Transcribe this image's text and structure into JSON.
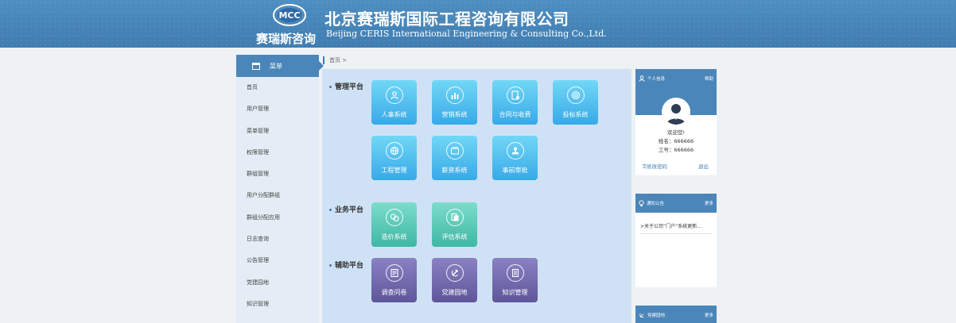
{
  "header": {
    "logo_text": "赛瑞斯咨询",
    "company_cn": "北京赛瑞斯国际工程咨询有限公司",
    "company_en": "Beijing CERIS International Engineering & Consulting Co.,Ltd."
  },
  "sidebar": {
    "title": "菜单",
    "items": [
      {
        "label": "首页"
      },
      {
        "label": "用户管理"
      },
      {
        "label": "菜单管理"
      },
      {
        "label": "权限管理"
      },
      {
        "label": "群组管理"
      },
      {
        "label": "用户分配群组"
      },
      {
        "label": "群组分配应用"
      },
      {
        "label": "日志查询"
      },
      {
        "label": "公告管理"
      },
      {
        "label": "党建园地"
      },
      {
        "label": "知识管理"
      }
    ]
  },
  "breadcrumb": {
    "text": "首页 >"
  },
  "sections": {
    "management": {
      "title": "管理平台"
    },
    "business": {
      "title": "业务平台"
    },
    "auxiliary": {
      "title": "辅助平台"
    }
  },
  "tiles": [
    {
      "label": "人事系统",
      "icon": "people-icon"
    },
    {
      "label": "营销系统",
      "icon": "bar-chart-icon"
    },
    {
      "label": "合同与收费",
      "icon": "contract-icon"
    },
    {
      "label": "投标系统",
      "icon": "target-icon"
    },
    {
      "label": "工程管理",
      "icon": "globe-icon"
    },
    {
      "label": "薪资系统",
      "icon": "wallet-icon"
    },
    {
      "label": "事前审批",
      "icon": "stamp-icon"
    },
    {
      "label": "造价系统",
      "icon": "coins-icon"
    },
    {
      "label": "评估系统",
      "icon": "document-icon"
    },
    {
      "label": "调查问卷",
      "icon": "survey-icon"
    },
    {
      "label": "党建园地",
      "icon": "hammer-sickle-icon"
    },
    {
      "label": "知识管理",
      "icon": "book-icon"
    }
  ],
  "user_panel": {
    "title": "个人信息",
    "help": "帮助",
    "welcome": "欢迎您!",
    "name_line": "姓名：666666",
    "id_line": "工号：666666",
    "change_password": "修改密码",
    "logout": "退出"
  },
  "notice_panel": {
    "title": "通知公告",
    "more": "更多",
    "items": [
      {
        "text": ">关于公司“门户”系统更新..."
      }
    ]
  },
  "party_panel": {
    "title": "党建园地",
    "more": "更多"
  },
  "colors": {
    "header": "#4f8ec0",
    "accent": "#4b86ba",
    "tile_blue": "#38a9e8",
    "tile_green": "#3fb7a4",
    "tile_purple": "#5f5699",
    "main_bg": "#cfe2f5"
  }
}
